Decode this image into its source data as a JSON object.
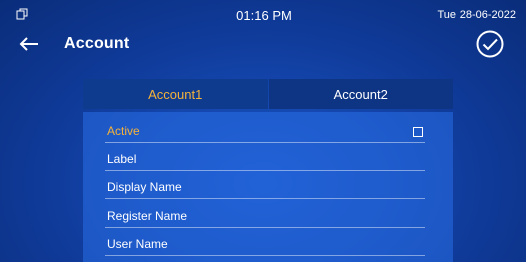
{
  "statusbar": {
    "time": "01:16 PM",
    "day": "Tue",
    "date": "28-06-2022"
  },
  "header": {
    "title": "Account"
  },
  "tabs": [
    {
      "label": "Account1"
    },
    {
      "label": "Account2"
    }
  ],
  "form": {
    "fields": [
      {
        "label": "Active"
      },
      {
        "label": "Label"
      },
      {
        "label": "Display Name"
      },
      {
        "label": "Register Name"
      },
      {
        "label": "User Name"
      }
    ]
  },
  "colors": {
    "accent": "#f5b33a",
    "text": "#ffffff",
    "background": "#1446ad"
  },
  "icons": {
    "status_left": "windows-icon",
    "back": "back-arrow-icon",
    "confirm": "check-circle-icon",
    "checkbox": "checkbox-icon"
  }
}
